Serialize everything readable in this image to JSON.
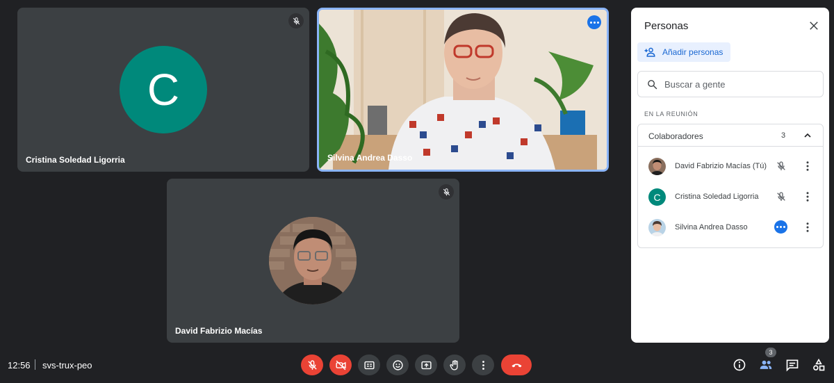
{
  "tiles": [
    {
      "name": "Cristina Soledad Ligorria",
      "initial": "C",
      "color": "#00897b",
      "muted": true
    },
    {
      "name": "Silvina Andrea Dasso",
      "active_speaker": true
    },
    {
      "name": "David Fabrizio Macías",
      "muted": true
    }
  ],
  "bottom_bar": {
    "time": "12:56",
    "meeting_code": "svs-trux-peo",
    "controls": [
      "mic-off-icon",
      "camera-off-icon",
      "captions-icon",
      "emoji-icon",
      "present-icon",
      "raise-hand-icon",
      "more-vert-icon",
      "call-end-icon"
    ],
    "right_controls": [
      "info-icon",
      "people-icon",
      "chat-icon",
      "activities-icon"
    ],
    "people_count": "3"
  },
  "panel": {
    "title": "Personas",
    "add_label": "Añadir personas",
    "search_placeholder": "Buscar a gente",
    "section_label": "EN LA REUNIÓN",
    "group": {
      "title": "Colaboradores",
      "count": "3",
      "people": [
        {
          "name": "David Fabrizio Macías (Tú)",
          "status": "mic-off"
        },
        {
          "name": "Cristina Soledad Ligorria",
          "initial": "C",
          "status": "mic-off"
        },
        {
          "name": "Silvina Andrea Dasso",
          "status": "speaking"
        }
      ]
    }
  },
  "colors": {
    "background": "#202124",
    "tile": "#3c4043",
    "accent": "#1a73e8",
    "danger": "#ea4335",
    "teal_avatar": "#00897b"
  }
}
